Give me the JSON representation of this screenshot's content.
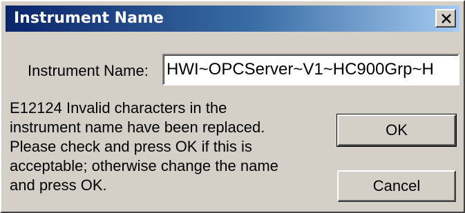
{
  "dialog": {
    "title": "Instrument Name",
    "close_glyph": "×",
    "close_icon": "close-icon"
  },
  "form": {
    "label": "Instrument Name:",
    "value": "HWI~OPCServer~V1~HC900Grp~H"
  },
  "message": {
    "lines": [
      "E12124 Invalid characters in the",
      "instrument name have been replaced.",
      "Please check and press OK if this is",
      "acceptable; otherwise change the name",
      "and press OK."
    ]
  },
  "buttons": {
    "ok": "OK",
    "cancel": "Cancel"
  },
  "colors": {
    "title_gradient_start": "#0a246a",
    "title_gradient_end": "#a6caf0",
    "face": "#d4d0c8"
  }
}
